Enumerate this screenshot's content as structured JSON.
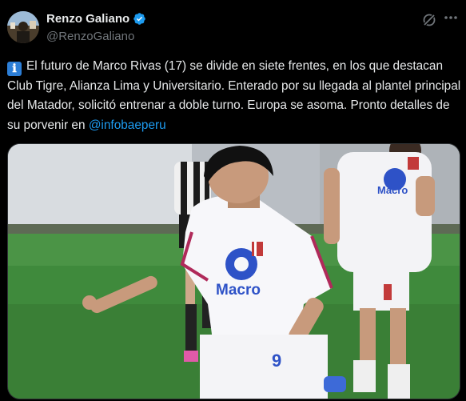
{
  "author": {
    "display_name": "Renzo Galiano",
    "handle": "@RenzoGaliano",
    "verified": true,
    "verified_color": "#1d9bf0"
  },
  "tweet": {
    "emoji": "ℹ",
    "body": "El futuro de Marco Rivas (17) se divide en siete frentes, en los que destacan Club Tigre, Alianza Lima y Universitario. Enterado por su llegada al plantel principal del Matador, solicitó entrenar a doble turno. Europa se asoma. Pronto detalles de su porvenir en ",
    "mention": "@infobaeperu",
    "mention_color": "#1d9bf0"
  },
  "media": {
    "jersey_sponsor": "Macro",
    "jersey_number": "9"
  },
  "icons": {
    "avatar": "avatar",
    "verified": "verified-badge-icon",
    "grok": "grok-icon",
    "more": "more-options-icon"
  },
  "colors": {
    "background": "#000000",
    "text": "#e7e9ea",
    "secondary_text": "#71767b",
    "accent": "#1d9bf0"
  }
}
